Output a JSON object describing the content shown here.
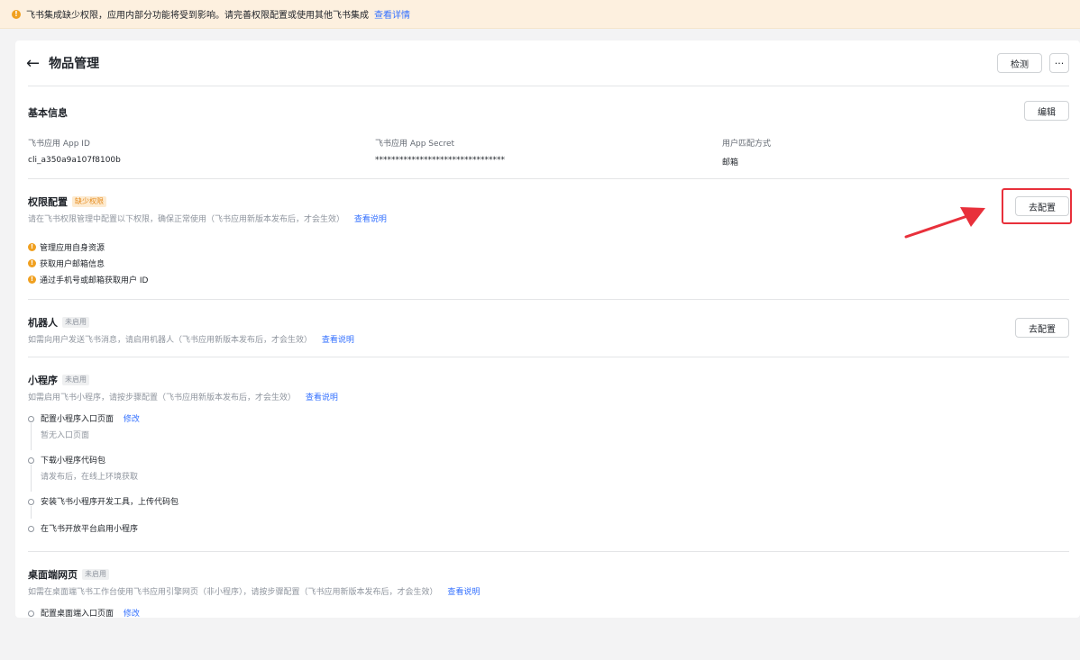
{
  "banner": {
    "text": "飞书集成缺少权限，应用内部分功能将受到影响。请完善权限配置或使用其他飞书集成",
    "link": "查看详情"
  },
  "header": {
    "title": "物品管理",
    "check_button": "检测",
    "more_button": "···"
  },
  "basic": {
    "title": "基本信息",
    "edit_button": "编辑",
    "fields": [
      {
        "label": "飞书应用 App ID",
        "value": "cli_a350a9a107f8100b"
      },
      {
        "label": "飞书应用 App Secret",
        "value": "********************************"
      },
      {
        "label": "用户匹配方式",
        "value": "邮箱"
      }
    ]
  },
  "permission": {
    "title": "权限配置",
    "tag": "缺少权限",
    "desc": "请在飞书权限管理中配置以下权限，确保正常使用（飞书应用新版本发布后，才会生效）",
    "link": "查看说明",
    "button": "去配置",
    "items": [
      "管理应用自身资源",
      "获取用户邮箱信息",
      "通过手机号或邮箱获取用户 ID"
    ]
  },
  "robot": {
    "title": "机器人",
    "tag": "未启用",
    "desc": "如需向用户发送飞书消息，请启用机器人（飞书应用新版本发布后，才会生效）",
    "link": "查看说明",
    "button": "去配置"
  },
  "mini": {
    "title": "小程序",
    "tag": "未启用",
    "desc": "如需启用飞书小程序，请按步骤配置（飞书应用新版本发布后，才会生效）",
    "link": "查看说明",
    "steps": [
      {
        "title": "配置小程序入口页面",
        "link": "修改",
        "sub": "暂无入口页面"
      },
      {
        "title": "下载小程序代码包",
        "sub": "请发布后，在线上环境获取"
      },
      {
        "title": "安装飞书小程序开发工具，上传代码包"
      },
      {
        "title": "在飞书开放平台启用小程序"
      }
    ]
  },
  "desktop": {
    "title": "桌面端网页",
    "tag": "未启用",
    "desc": "如需在桌面端飞书工作台使用飞书应用引擎网页（非小程序），请按步骤配置（飞书应用新版本发布后，才会生效）",
    "link": "查看说明",
    "steps": [
      {
        "title": "配置桌面端入口页面",
        "link": "修改"
      }
    ]
  },
  "colors": {
    "accent": "#3370ff",
    "warning": "#f0a020",
    "highlight": "#e8303b"
  }
}
